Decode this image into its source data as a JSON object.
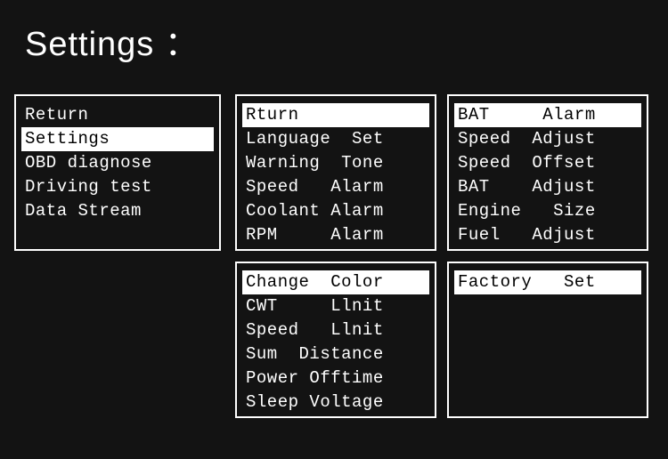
{
  "title": "Settings ：",
  "panels": {
    "main": [
      {
        "label": "Return",
        "selected": false
      },
      {
        "label": "Settings",
        "selected": true
      },
      {
        "label": "OBD diagnose",
        "selected": false
      },
      {
        "label": "Driving test",
        "selected": false
      },
      {
        "label": "Data Stream",
        "selected": false
      }
    ],
    "set1": [
      {
        "label": "Rturn",
        "selected": true
      },
      {
        "label": "Language  Set",
        "selected": false
      },
      {
        "label": "Warning  Tone",
        "selected": false
      },
      {
        "label": "Speed   Alarm",
        "selected": false
      },
      {
        "label": "Coolant Alarm",
        "selected": false
      },
      {
        "label": "RPM     Alarm",
        "selected": false
      }
    ],
    "set2": [
      {
        "label": "BAT     Alarm",
        "selected": true
      },
      {
        "label": "Speed  Adjust",
        "selected": false
      },
      {
        "label": "Speed  Offset",
        "selected": false
      },
      {
        "label": "BAT    Adjust",
        "selected": false
      },
      {
        "label": "Engine   Size",
        "selected": false
      },
      {
        "label": "Fuel   Adjust",
        "selected": false
      }
    ],
    "set3": [
      {
        "label": "Change  Color",
        "selected": true
      },
      {
        "label": "CWT     Llnit",
        "selected": false
      },
      {
        "label": "Speed   Llnit",
        "selected": false
      },
      {
        "label": "Sum  Distance",
        "selected": false
      },
      {
        "label": "Power Offtime",
        "selected": false
      },
      {
        "label": "Sleep Voltage",
        "selected": false
      }
    ],
    "set4": [
      {
        "label": "Factory   Set",
        "selected": true
      }
    ]
  }
}
